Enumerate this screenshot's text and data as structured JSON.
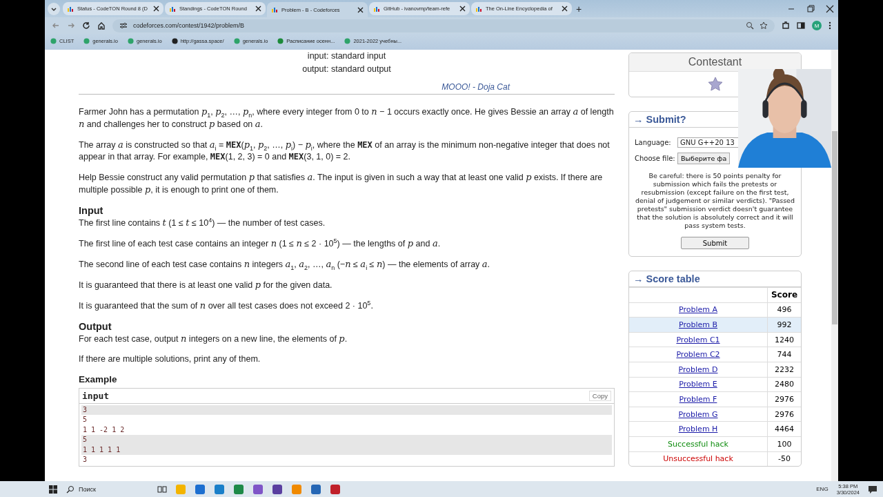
{
  "browser": {
    "tabs": [
      {
        "title": "Status - CodeTON Round 8 (D",
        "selected": false
      },
      {
        "title": "Standings - CodeTON Round",
        "selected": false
      },
      {
        "title": "Problem - B - Codeforces",
        "selected": true
      },
      {
        "title": "GitHub - ivanovmp/team-refe",
        "selected": false
      },
      {
        "title": "The On-Line Encyclopedia of",
        "selected": false
      }
    ],
    "new_tab": "+",
    "url": "codeforces.com/contest/1942/problem/B",
    "profile": "M",
    "bookmarks": [
      "CLIST",
      "generals.io",
      "generals.io",
      "http://gassa.space/",
      "generals.io",
      "Расписание осенн...",
      "2021-2022 учебны..."
    ]
  },
  "problem": {
    "io": [
      "input: standard input",
      "output: standard output"
    ],
    "epigraph": "MOOO! - Doja Cat",
    "blocks": [
      {
        "kind": "para",
        "text": "Farmer John has a permutation *p*$_{1}$, *p*$_{2}$, …, *p*$_{n}$, where every integer from 0 to *n* − 1 occurs exactly once. He gives Bessie an array *a* of length *n* and challenges her to construct *p* based on *a*."
      },
      {
        "kind": "para",
        "text": "The array *a* is constructed so that *a*$_{i}$ = **MEX**(*p*$_{1}$, *p*$_{2}$, …, *p*$_{i}$) − *p*$_{i}$, where the **MEX** of an array is the minimum non-negative integer that does not appear in that array. For example, **MEX**(1, 2, 3) = 0 and **MEX**(3, 1, 0) = 2."
      },
      {
        "kind": "para",
        "text": "Help Bessie construct any valid permutation *p* that satisfies *a*. The input is given in such a way that at least one valid *p* exists. If there are multiple possible *p*, it is enough to print one of them."
      },
      {
        "kind": "heading",
        "text": "Input"
      },
      {
        "kind": "para",
        "text": "The first line contains *t* (1 ≤ *t* ≤ 10$^{4}$) — the number of test cases."
      },
      {
        "kind": "para",
        "text": "The first line of each test case contains an integer *n* (1 ≤ *n* ≤ 2 · 10$^{5}$) — the lengths of *p* and *a*."
      },
      {
        "kind": "para",
        "text": "The second line of each test case contains *n* integers *a*$_{1}$, *a*$_{2}$, …, *a*$_{n}$ (−*n* ≤ *a*$_{i}$ ≤ *n*) — the elements of array *a*."
      },
      {
        "kind": "para",
        "text": "It is guaranteed that there is at least one valid *p* for the given data."
      },
      {
        "kind": "para",
        "text": "It is guaranteed that the sum of *n* over all test cases does not exceed 2 · 10$^{5}$."
      },
      {
        "kind": "heading",
        "text": "Output"
      },
      {
        "kind": "para",
        "text": "For each test case, output *n* integers on a new line, the elements of *p*."
      },
      {
        "kind": "para",
        "text": "If there are multiple solutions, print any of them."
      }
    ],
    "example": {
      "title": "Example",
      "label": "input",
      "copy": "Copy",
      "lines": [
        {
          "text": "3",
          "shaded": true
        },
        {
          "text": "5",
          "shaded": false
        },
        {
          "text": "1 1 -2 1 2",
          "shaded": false
        },
        {
          "text": "5",
          "shaded": true
        },
        {
          "text": "1 1 1 1 1",
          "shaded": true
        },
        {
          "text": "3",
          "shaded": false
        }
      ]
    }
  },
  "sidebar": {
    "contestant": {
      "title": "Contestant"
    },
    "submit": {
      "title": "→ Submit?",
      "language_label": "Language:",
      "language": "GNU G++20 13",
      "file_label": "Choose file:",
      "file_button": "Выберите фа",
      "warning": "Be careful: there is 50 points penalty for submission which fails the pretests or resubmission (except failure on the first test, denial of judgement or similar verdicts). \"Passed pretests\" submission verdict doesn't guarantee that the solution is absolutely correct and it will pass system tests.",
      "button": "Submit"
    },
    "score_table": {
      "title": "→ Score table",
      "column": "Score",
      "rows": [
        {
          "kind": "problem",
          "name": "Problem A",
          "score": "496",
          "selected": false
        },
        {
          "kind": "problem",
          "name": "Problem B",
          "score": "992",
          "selected": true
        },
        {
          "kind": "problem",
          "name": "Problem C1",
          "score": "1240",
          "selected": false
        },
        {
          "kind": "problem",
          "name": "Problem C2",
          "score": "744",
          "selected": false
        },
        {
          "kind": "problem",
          "name": "Problem D",
          "score": "2232",
          "selected": false
        },
        {
          "kind": "problem",
          "name": "Problem E",
          "score": "2480",
          "selected": false
        },
        {
          "kind": "problem",
          "name": "Problem F",
          "score": "2976",
          "selected": false
        },
        {
          "kind": "problem",
          "name": "Problem G",
          "score": "2976",
          "selected": false
        },
        {
          "kind": "problem",
          "name": "Problem H",
          "score": "4464",
          "selected": false
        },
        {
          "kind": "success",
          "name": "Successful hack",
          "score": "100",
          "selected": false
        },
        {
          "kind": "fail",
          "name": "Unsuccessful hack",
          "score": "-50",
          "selected": false
        }
      ]
    }
  },
  "taskbar": {
    "search": "Поиск",
    "language": "ENG",
    "time": "5:38 PM",
    "date": "3/30/2024"
  }
}
